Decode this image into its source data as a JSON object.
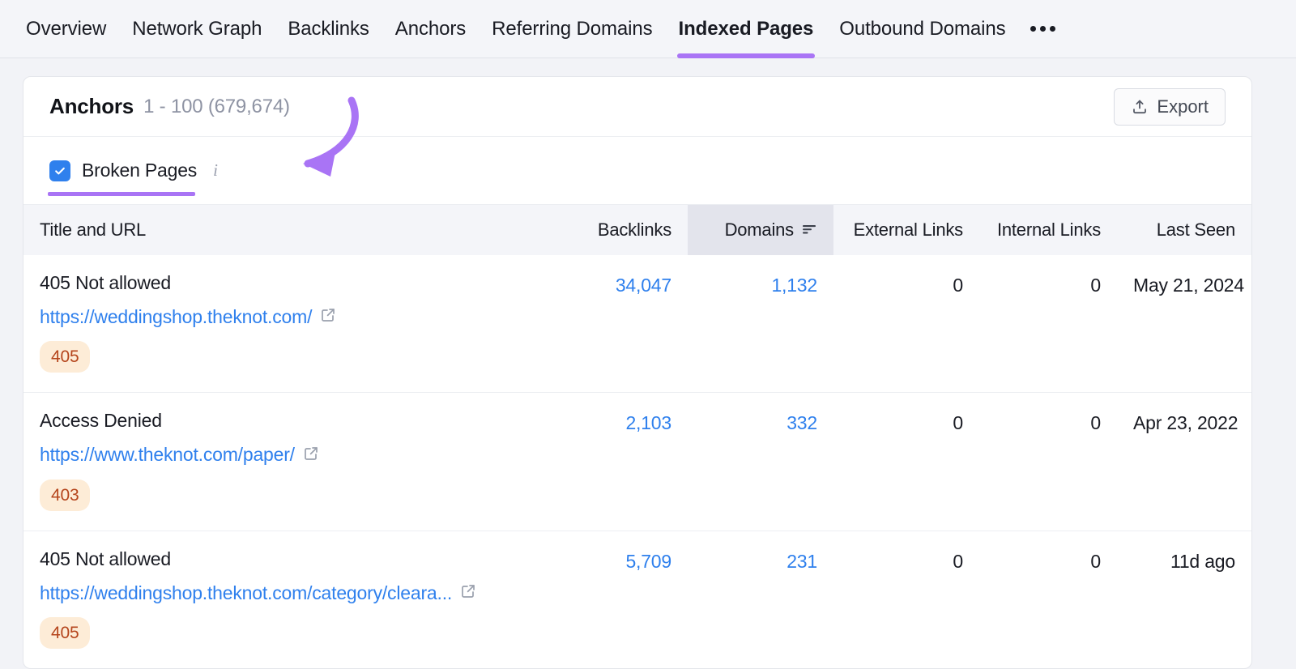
{
  "tabs": [
    {
      "label": "Overview",
      "active": false
    },
    {
      "label": "Network Graph",
      "active": false
    },
    {
      "label": "Backlinks",
      "active": false
    },
    {
      "label": "Anchors",
      "active": false
    },
    {
      "label": "Referring Domains",
      "active": false
    },
    {
      "label": "Indexed Pages",
      "active": true
    },
    {
      "label": "Outbound Domains",
      "active": false
    }
  ],
  "overflow_menu": "more-options",
  "card": {
    "title": "Anchors",
    "count": "1 - 100 (679,674)",
    "export_label": "Export"
  },
  "filter": {
    "checkbox_label": "Broken Pages",
    "checked": true,
    "info_tooltip": "i"
  },
  "table": {
    "columns": [
      {
        "label": "Title and URL",
        "align": "left",
        "sorted": false
      },
      {
        "label": "Backlinks",
        "align": "right",
        "sorted": false
      },
      {
        "label": "Domains",
        "align": "right",
        "sorted": true
      },
      {
        "label": "External Links",
        "align": "right",
        "sorted": false
      },
      {
        "label": "Internal Links",
        "align": "right",
        "sorted": false
      },
      {
        "label": "Last Seen",
        "align": "right",
        "sorted": false
      }
    ],
    "rows": [
      {
        "title": "405 Not allowed",
        "url": "https://weddingshop.theknot.com/",
        "status": "405",
        "backlinks": "34,047",
        "domains": "1,132",
        "external_links": "0",
        "internal_links": "0",
        "last_seen": "May 21, 2024"
      },
      {
        "title": "Access Denied",
        "url": "https://www.theknot.com/paper/",
        "status": "403",
        "backlinks": "2,103",
        "domains": "332",
        "external_links": "0",
        "internal_links": "0",
        "last_seen": "Apr 23, 2022"
      },
      {
        "title": "405 Not allowed",
        "url": "https://weddingshop.theknot.com/category/cleara...",
        "status": "405",
        "backlinks": "5,709",
        "domains": "231",
        "external_links": "0",
        "internal_links": "0",
        "last_seen": "11d ago"
      }
    ]
  },
  "colors": {
    "accent_purple": "#a974f5",
    "link_blue": "#2f80ed",
    "badge_bg": "#fdecd7",
    "badge_text": "#b5451c",
    "page_bg": "#f2f3f7"
  }
}
